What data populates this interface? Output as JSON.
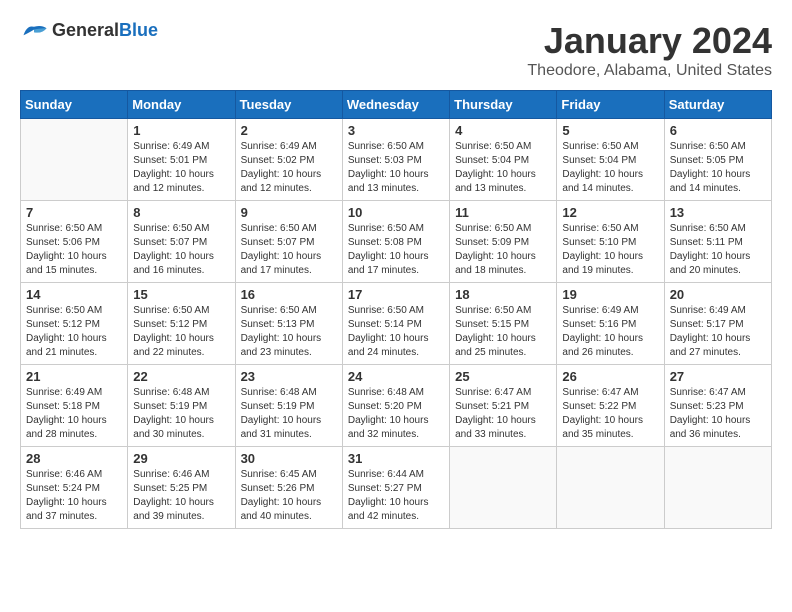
{
  "header": {
    "logo_general": "General",
    "logo_blue": "Blue",
    "title": "January 2024",
    "subtitle": "Theodore, Alabama, United States"
  },
  "weekdays": [
    "Sunday",
    "Monday",
    "Tuesday",
    "Wednesday",
    "Thursday",
    "Friday",
    "Saturday"
  ],
  "weeks": [
    [
      {
        "day": "",
        "sunrise": "",
        "sunset": "",
        "daylight": ""
      },
      {
        "day": "1",
        "sunrise": "Sunrise: 6:49 AM",
        "sunset": "Sunset: 5:01 PM",
        "daylight": "Daylight: 10 hours and 12 minutes."
      },
      {
        "day": "2",
        "sunrise": "Sunrise: 6:49 AM",
        "sunset": "Sunset: 5:02 PM",
        "daylight": "Daylight: 10 hours and 12 minutes."
      },
      {
        "day": "3",
        "sunrise": "Sunrise: 6:50 AM",
        "sunset": "Sunset: 5:03 PM",
        "daylight": "Daylight: 10 hours and 13 minutes."
      },
      {
        "day": "4",
        "sunrise": "Sunrise: 6:50 AM",
        "sunset": "Sunset: 5:04 PM",
        "daylight": "Daylight: 10 hours and 13 minutes."
      },
      {
        "day": "5",
        "sunrise": "Sunrise: 6:50 AM",
        "sunset": "Sunset: 5:04 PM",
        "daylight": "Daylight: 10 hours and 14 minutes."
      },
      {
        "day": "6",
        "sunrise": "Sunrise: 6:50 AM",
        "sunset": "Sunset: 5:05 PM",
        "daylight": "Daylight: 10 hours and 14 minutes."
      }
    ],
    [
      {
        "day": "7",
        "sunrise": "Sunrise: 6:50 AM",
        "sunset": "Sunset: 5:06 PM",
        "daylight": "Daylight: 10 hours and 15 minutes."
      },
      {
        "day": "8",
        "sunrise": "Sunrise: 6:50 AM",
        "sunset": "Sunset: 5:07 PM",
        "daylight": "Daylight: 10 hours and 16 minutes."
      },
      {
        "day": "9",
        "sunrise": "Sunrise: 6:50 AM",
        "sunset": "Sunset: 5:07 PM",
        "daylight": "Daylight: 10 hours and 17 minutes."
      },
      {
        "day": "10",
        "sunrise": "Sunrise: 6:50 AM",
        "sunset": "Sunset: 5:08 PM",
        "daylight": "Daylight: 10 hours and 17 minutes."
      },
      {
        "day": "11",
        "sunrise": "Sunrise: 6:50 AM",
        "sunset": "Sunset: 5:09 PM",
        "daylight": "Daylight: 10 hours and 18 minutes."
      },
      {
        "day": "12",
        "sunrise": "Sunrise: 6:50 AM",
        "sunset": "Sunset: 5:10 PM",
        "daylight": "Daylight: 10 hours and 19 minutes."
      },
      {
        "day": "13",
        "sunrise": "Sunrise: 6:50 AM",
        "sunset": "Sunset: 5:11 PM",
        "daylight": "Daylight: 10 hours and 20 minutes."
      }
    ],
    [
      {
        "day": "14",
        "sunrise": "Sunrise: 6:50 AM",
        "sunset": "Sunset: 5:12 PM",
        "daylight": "Daylight: 10 hours and 21 minutes."
      },
      {
        "day": "15",
        "sunrise": "Sunrise: 6:50 AM",
        "sunset": "Sunset: 5:12 PM",
        "daylight": "Daylight: 10 hours and 22 minutes."
      },
      {
        "day": "16",
        "sunrise": "Sunrise: 6:50 AM",
        "sunset": "Sunset: 5:13 PM",
        "daylight": "Daylight: 10 hours and 23 minutes."
      },
      {
        "day": "17",
        "sunrise": "Sunrise: 6:50 AM",
        "sunset": "Sunset: 5:14 PM",
        "daylight": "Daylight: 10 hours and 24 minutes."
      },
      {
        "day": "18",
        "sunrise": "Sunrise: 6:50 AM",
        "sunset": "Sunset: 5:15 PM",
        "daylight": "Daylight: 10 hours and 25 minutes."
      },
      {
        "day": "19",
        "sunrise": "Sunrise: 6:49 AM",
        "sunset": "Sunset: 5:16 PM",
        "daylight": "Daylight: 10 hours and 26 minutes."
      },
      {
        "day": "20",
        "sunrise": "Sunrise: 6:49 AM",
        "sunset": "Sunset: 5:17 PM",
        "daylight": "Daylight: 10 hours and 27 minutes."
      }
    ],
    [
      {
        "day": "21",
        "sunrise": "Sunrise: 6:49 AM",
        "sunset": "Sunset: 5:18 PM",
        "daylight": "Daylight: 10 hours and 28 minutes."
      },
      {
        "day": "22",
        "sunrise": "Sunrise: 6:48 AM",
        "sunset": "Sunset: 5:19 PM",
        "daylight": "Daylight: 10 hours and 30 minutes."
      },
      {
        "day": "23",
        "sunrise": "Sunrise: 6:48 AM",
        "sunset": "Sunset: 5:19 PM",
        "daylight": "Daylight: 10 hours and 31 minutes."
      },
      {
        "day": "24",
        "sunrise": "Sunrise: 6:48 AM",
        "sunset": "Sunset: 5:20 PM",
        "daylight": "Daylight: 10 hours and 32 minutes."
      },
      {
        "day": "25",
        "sunrise": "Sunrise: 6:47 AM",
        "sunset": "Sunset: 5:21 PM",
        "daylight": "Daylight: 10 hours and 33 minutes."
      },
      {
        "day": "26",
        "sunrise": "Sunrise: 6:47 AM",
        "sunset": "Sunset: 5:22 PM",
        "daylight": "Daylight: 10 hours and 35 minutes."
      },
      {
        "day": "27",
        "sunrise": "Sunrise: 6:47 AM",
        "sunset": "Sunset: 5:23 PM",
        "daylight": "Daylight: 10 hours and 36 minutes."
      }
    ],
    [
      {
        "day": "28",
        "sunrise": "Sunrise: 6:46 AM",
        "sunset": "Sunset: 5:24 PM",
        "daylight": "Daylight: 10 hours and 37 minutes."
      },
      {
        "day": "29",
        "sunrise": "Sunrise: 6:46 AM",
        "sunset": "Sunset: 5:25 PM",
        "daylight": "Daylight: 10 hours and 39 minutes."
      },
      {
        "day": "30",
        "sunrise": "Sunrise: 6:45 AM",
        "sunset": "Sunset: 5:26 PM",
        "daylight": "Daylight: 10 hours and 40 minutes."
      },
      {
        "day": "31",
        "sunrise": "Sunrise: 6:44 AM",
        "sunset": "Sunset: 5:27 PM",
        "daylight": "Daylight: 10 hours and 42 minutes."
      },
      {
        "day": "",
        "sunrise": "",
        "sunset": "",
        "daylight": ""
      },
      {
        "day": "",
        "sunrise": "",
        "sunset": "",
        "daylight": ""
      },
      {
        "day": "",
        "sunrise": "",
        "sunset": "",
        "daylight": ""
      }
    ]
  ]
}
